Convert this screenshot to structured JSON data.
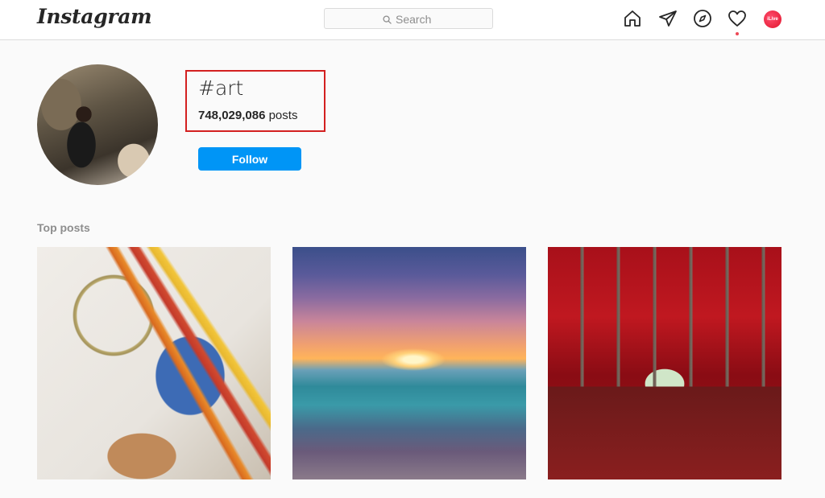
{
  "header": {
    "logo": "Instagram",
    "search": {
      "placeholder": "Search"
    },
    "nav": [
      {
        "name": "home-icon"
      },
      {
        "name": "direct-message-icon"
      },
      {
        "name": "explore-icon"
      },
      {
        "name": "activity-heart-icon"
      }
    ],
    "avatar_text": "iLive"
  },
  "hashtag": {
    "title": "#art",
    "post_count": "748,029,086",
    "posts_label": "posts",
    "follow_label": "Follow"
  },
  "section": {
    "title": "Top posts"
  },
  "colors": {
    "accent": "#0095f6",
    "highlight_box": "#d32020",
    "notification_dot": "#ed4956"
  }
}
